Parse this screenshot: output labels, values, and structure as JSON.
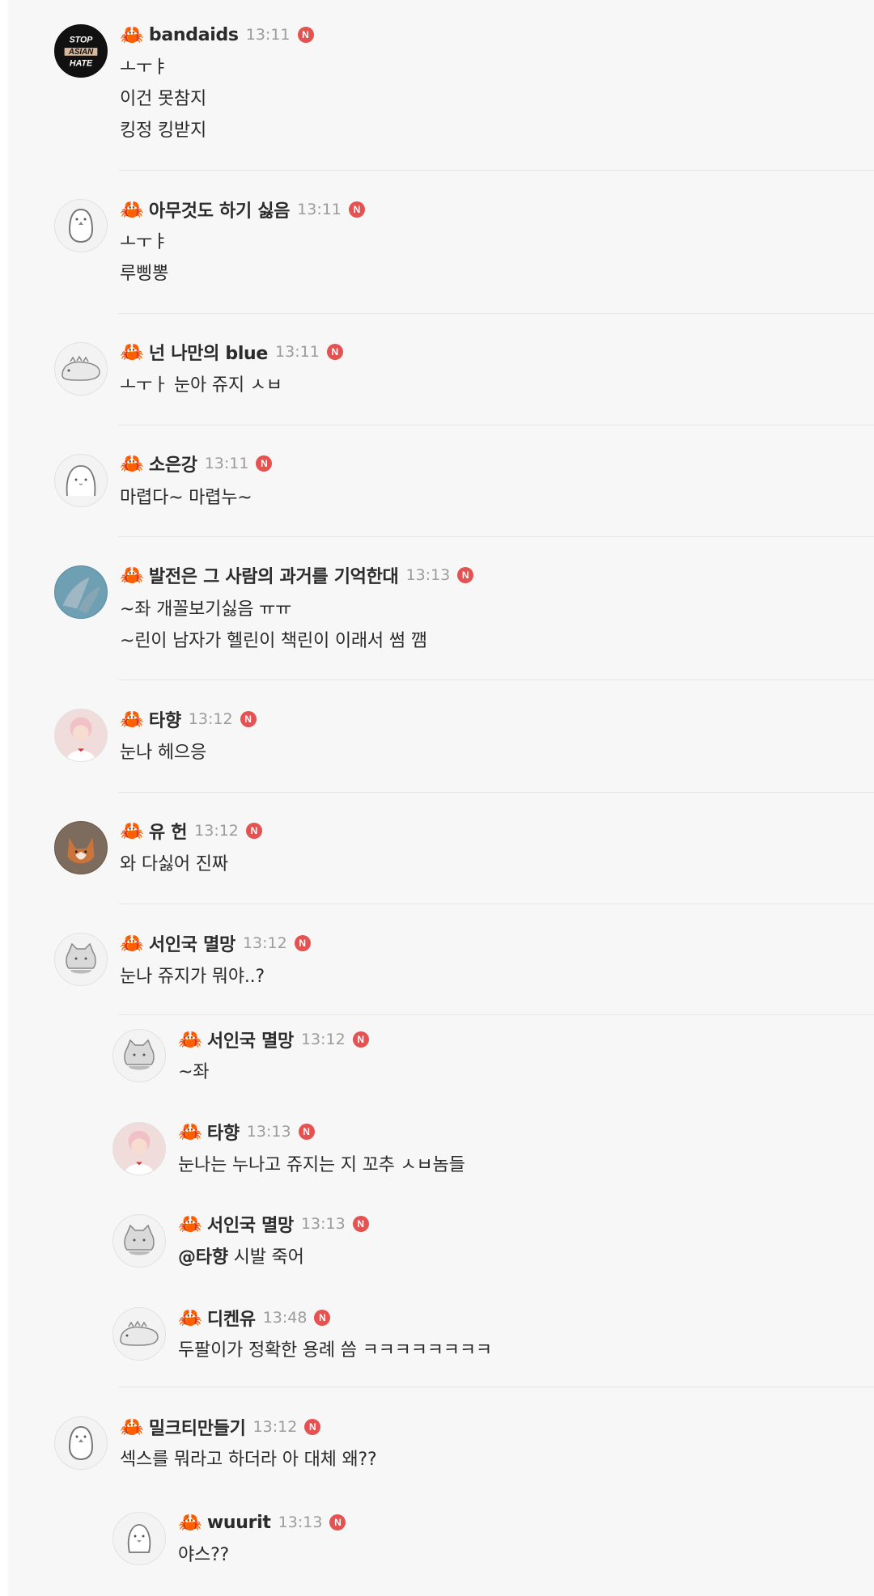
{
  "badge_label": "N",
  "emoji": "🦀",
  "comments": [
    {
      "name": "bandaids",
      "time": "13:11",
      "lines": [
        "ㅗㅜㅑ",
        "이건 못참지",
        "킹정 킹받지"
      ],
      "avatar_text": [
        "STOP",
        "ASIAN",
        "HATE"
      ]
    },
    {
      "name": "아무것도 하기 싫음",
      "time": "13:11",
      "lines": [
        "ㅗㅜㅑ",
        "루삥뽕"
      ]
    },
    {
      "name": "넌 나만의 blue",
      "time": "13:11",
      "lines": [
        "ㅗㅜㅏ 눈아 쥬지 ㅅㅂ"
      ]
    },
    {
      "name": "소은강",
      "time": "13:11",
      "lines": [
        "마렵다~ 마렵누~"
      ]
    },
    {
      "name": "발전은 그 사람의 과거를 기억한대",
      "time": "13:13",
      "lines": [
        "~좌 개꼴보기싫음 ㅠㅠ",
        "~린이 남자가 헬린이 책린이 이래서 썸 깸"
      ]
    },
    {
      "name": "타향",
      "time": "13:12",
      "lines": [
        "눈나 헤으응"
      ]
    },
    {
      "name": "유 헌",
      "time": "13:12",
      "lines": [
        "와 다싫어 진짜"
      ]
    },
    {
      "name": "서인국 멸망",
      "time": "13:12",
      "lines": [
        "눈나 쥬지가 뭐야..?"
      ]
    },
    {
      "name": "서인국 멸망",
      "time": "13:12",
      "lines": [
        "~좌"
      ]
    },
    {
      "name": "타향",
      "time": "13:13",
      "lines": [
        "눈나는 누나고 쥬지는 지 꼬추 ㅅㅂ놈들"
      ]
    },
    {
      "name": "서인국 멸망",
      "time": "13:13",
      "mention": "@타향",
      "lines": [
        " 시발 죽어"
      ]
    },
    {
      "name": "디켄유",
      "time": "13:48",
      "lines": [
        "두팔이가 정확한 용례 씀 ㅋㅋㅋㅋㅋㅋㅋㅋ"
      ]
    },
    {
      "name": "밀크티만들기",
      "time": "13:12",
      "lines": [
        "섹스를 뭐라고 하더라 아 대체 왜??"
      ]
    },
    {
      "name": "wuurit",
      "time": "13:13",
      "lines": [
        "야스??"
      ]
    }
  ],
  "colors": {
    "badge": "#e55252",
    "time": "#9c9c9c",
    "background": "#f7f7f7"
  }
}
